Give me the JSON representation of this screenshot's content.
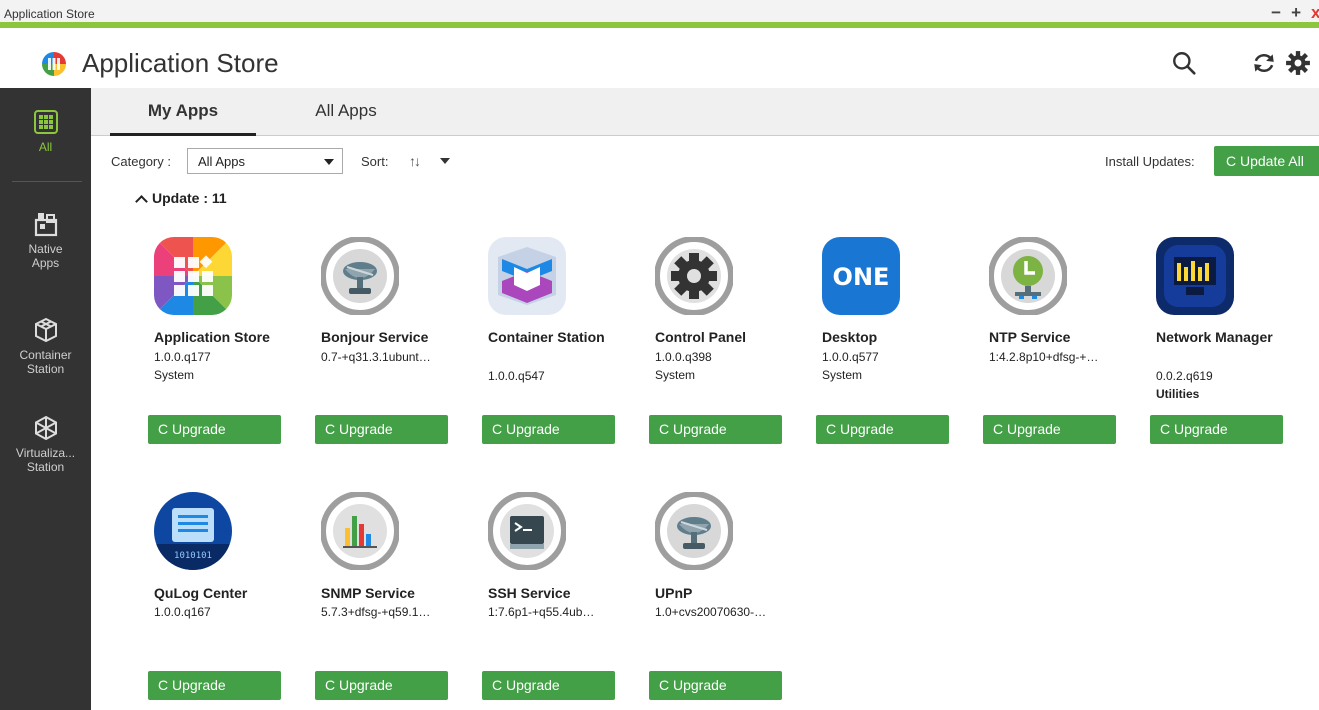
{
  "window": {
    "title": "Application Store",
    "minimize": "−",
    "maximize": "+",
    "close": "x"
  },
  "header": {
    "title": "Application Store"
  },
  "sidebar": {
    "items": [
      {
        "label": "All",
        "icon": "grid-icon",
        "active": true
      },
      {
        "label": "Native Apps",
        "icon": "native-apps-icon"
      },
      {
        "label": "Container Station",
        "icon": "container-icon"
      },
      {
        "label": "Virtualiza... Station",
        "icon": "virtualization-icon"
      }
    ]
  },
  "tabs": [
    {
      "label": "My Apps",
      "active": true
    },
    {
      "label": "All Apps"
    }
  ],
  "filters": {
    "category_label": "Category :",
    "category_value": "All Apps",
    "sort_label": "Sort:",
    "sort_symbol": "↑↓",
    "install_updates_label": "Install Updates:",
    "update_all_label": "C Update All"
  },
  "section": {
    "title": "Update : 11"
  },
  "upgrade_label": "C  Upgrade",
  "apps": [
    {
      "name": "Application Store",
      "version": "1.0.0.q177",
      "category": "System"
    },
    {
      "name": "Bonjour Service",
      "version": "0.7-+q31.3.1ubunt…",
      "category": ""
    },
    {
      "name": "Container Station",
      "version": "1.0.0.q547",
      "category": ""
    },
    {
      "name": "Control Panel",
      "version": "1.0.0.q398",
      "category": "System"
    },
    {
      "name": "Desktop",
      "version": "1.0.0.q577",
      "category": "System",
      "icon_text": "ONE"
    },
    {
      "name": "NTP Service",
      "version": "1:4.2.8p10+dfsg-+…",
      "category": ""
    },
    {
      "name": "Network Manager",
      "version": "0.0.2.q619",
      "category": "Utilities"
    },
    {
      "name": "QuLog Center",
      "version": "1.0.0.q167",
      "category": "",
      "icon_text": "1010101"
    },
    {
      "name": "SNMP Service",
      "version": "5.7.3+dfsg-+q59.1…",
      "category": ""
    },
    {
      "name": "SSH Service",
      "version": "1:7.6p1-+q55.4ub…",
      "category": ""
    },
    {
      "name": "UPnP",
      "version": "1.0+cvs20070630-…",
      "category": ""
    }
  ],
  "colors": {
    "accent": "#8cc63f",
    "button_green": "#43a047",
    "sidebar_bg": "#333333"
  }
}
